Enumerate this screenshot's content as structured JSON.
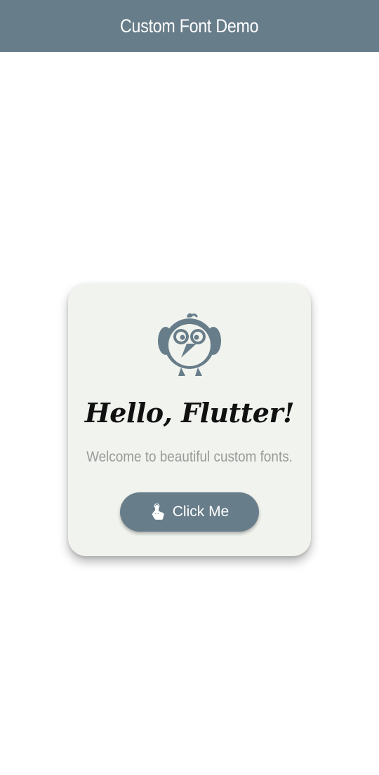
{
  "appbar": {
    "title": "Custom Font Demo"
  },
  "card": {
    "headline": "Hello, Flutter!",
    "subtitle": "Welcome to beautiful custom fonts.",
    "button_label": "Click Me",
    "button_icon": "touch-app-icon",
    "mascot_icon": "bird-mascot-icon"
  },
  "colors": {
    "primary": "#687d8a",
    "card_background": "#f1f3ee",
    "subtitle_text": "#9a9a9a"
  }
}
